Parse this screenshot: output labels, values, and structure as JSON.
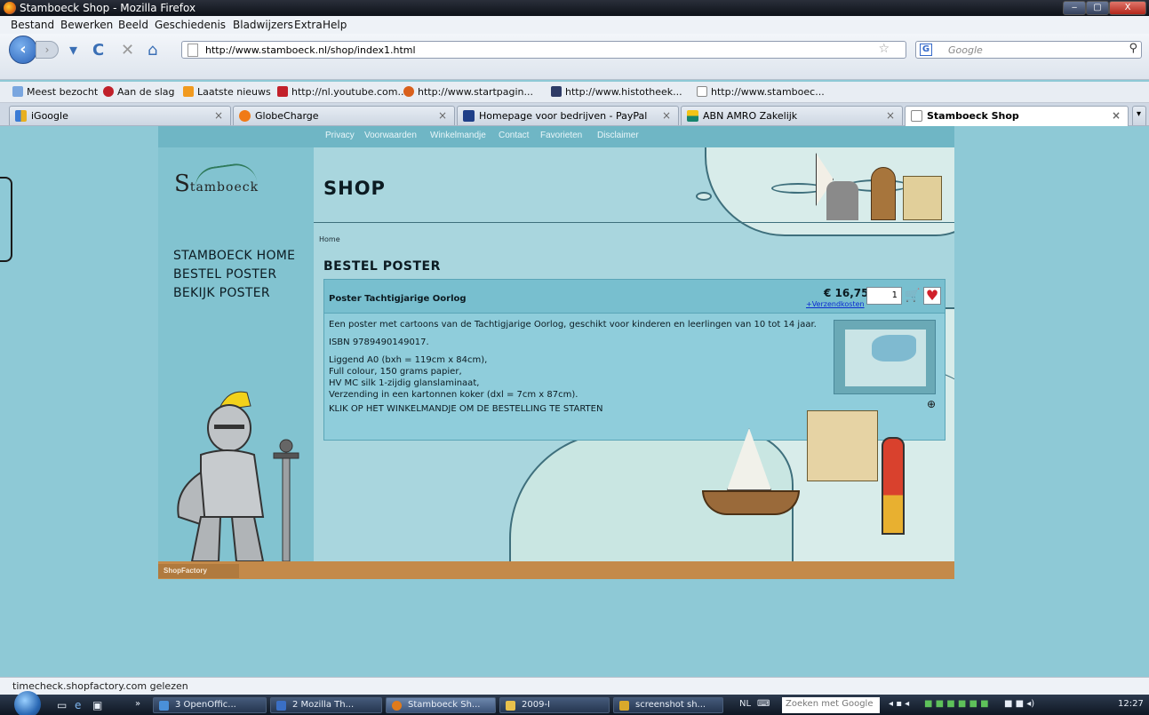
{
  "window": {
    "title": "Stamboeck Shop - Mozilla Firefox",
    "min": "‒",
    "max": "▢",
    "close": "X"
  },
  "menu": [
    "Bestand",
    "Bewerken",
    "Beeld",
    "Geschiedenis",
    "Bladwijzers",
    "Extra",
    "Help"
  ],
  "nav": {
    "url": "http://www.stamboeck.nl/shop/index1.html",
    "search_placeholder": "Google"
  },
  "bookmarks": [
    "Meest bezocht",
    "Aan de slag",
    "Laatste nieuws",
    "http://nl.youtube.com...",
    "http://www.startpagin...",
    "http://www.histotheek...",
    "http://www.stamboec..."
  ],
  "tabs": [
    "iGoogle",
    "GlobeCharge",
    "Homepage voor bedrijven - PayPal",
    "ABN AMRO Zakelijk",
    "Stamboeck Shop"
  ],
  "site": {
    "topnav": [
      "Privacy",
      "Voorwaarden",
      "Winkelmandje",
      "Contact",
      "Favorieten",
      "Disclaimer"
    ],
    "logo_s": "S",
    "logo_rest": "tamboeck",
    "shop_title": "SHOP",
    "breadcrumb": "Home",
    "sidenav": [
      "STAMBOECK HOME",
      "BESTEL POSTER",
      "BEKIJK POSTER"
    ],
    "section_title": "BESTEL POSTER",
    "product": {
      "name": "Poster Tachtigjarige Oorlog",
      "price": "€ 16,75",
      "shipping_link": "+Verzendkosten",
      "quantity": "1",
      "description": "Een poster met cartoons van de Tachtigjarige Oorlog, geschikt voor kinderen en leerlingen van 10 tot 14 jaar.",
      "isbn": "ISBN 9789490149017.",
      "specs": [
        "Liggend A0 (bxh = 119cm x 84cm),",
        "Full colour, 150 grams papier,",
        "HV MC silk 1-zijdig glanslaminaat,",
        "Verzending in een kartonnen koker (dxl = 7cm x 87cm)."
      ],
      "cta": "KLIK OP HET WINKELMANDJE OM DE BESTELLING TE STARTEN"
    },
    "footer": "ShopFactory"
  },
  "status": "timecheck.shopfactory.com gelezen",
  "taskbar": {
    "items": [
      "3 OpenOffic...",
      "2 Mozilla Th...",
      "Stamboeck Sh...",
      "2009-I",
      "screenshot sh..."
    ],
    "lang": "NL",
    "search": "Zoeken met Google",
    "clock": "12:27"
  }
}
